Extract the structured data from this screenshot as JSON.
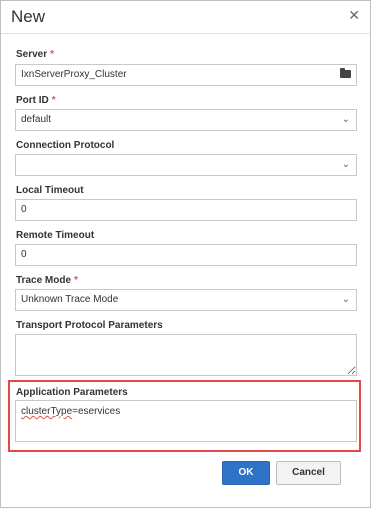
{
  "dialog": {
    "title": "New",
    "close_icon": "close-icon"
  },
  "fields": {
    "server": {
      "label": "Server",
      "required": "*",
      "value": "IxnServerProxy_Cluster",
      "icon": "folder-icon"
    },
    "port_id": {
      "label": "Port ID",
      "required": "*",
      "value": "default",
      "icon": "chevron-down-icon"
    },
    "connection_protocol": {
      "label": "Connection Protocol",
      "value": "",
      "icon": "chevron-down-icon"
    },
    "local_timeout": {
      "label": "Local Timeout",
      "value": "0"
    },
    "remote_timeout": {
      "label": "Remote Timeout",
      "value": "0"
    },
    "trace_mode": {
      "label": "Trace Mode",
      "required": "*",
      "value": "Unknown Trace Mode",
      "icon": "chevron-down-icon"
    },
    "transport_protocol_parameters": {
      "label": "Transport Protocol Parameters",
      "value": ""
    },
    "application_parameters": {
      "label": "Application Parameters",
      "value_prefix": "clusterType",
      "value_suffix": "=eservices"
    }
  },
  "buttons": {
    "ok": "OK",
    "cancel": "Cancel"
  },
  "colors": {
    "required": "#d9534f",
    "highlight": "#e24a4a",
    "primary": "#2f73c9"
  }
}
